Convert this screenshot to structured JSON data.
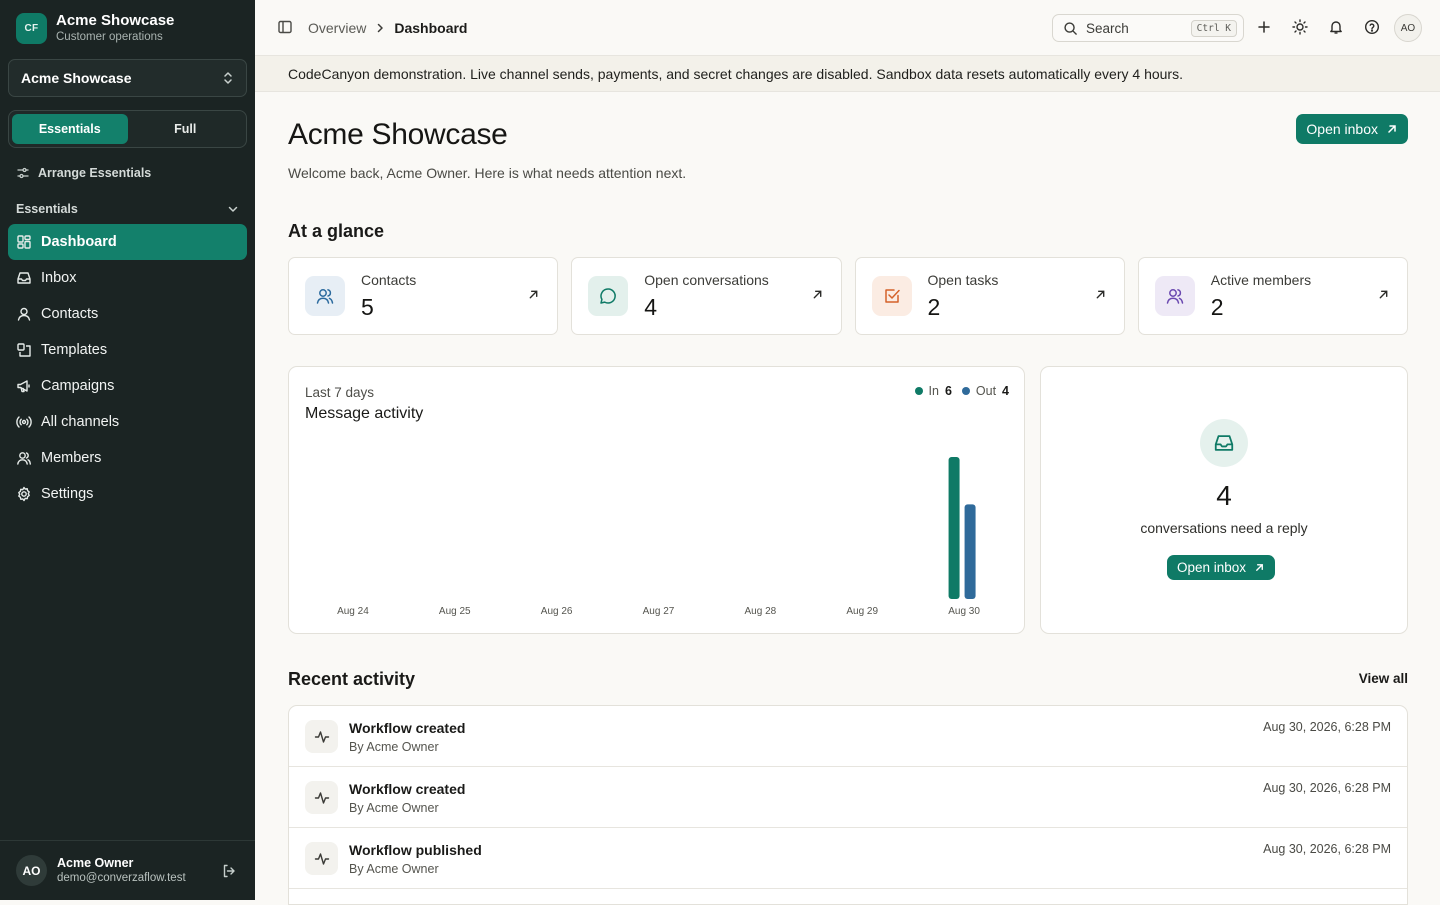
{
  "sidebar": {
    "brand": {
      "initials": "CF",
      "name": "Acme Showcase",
      "subtitle": "Customer operations"
    },
    "workspace": "Acme Showcase",
    "modes": [
      "Essentials",
      "Full"
    ],
    "arrange_label": "Arrange Essentials",
    "section_label": "Essentials",
    "items": [
      {
        "label": "Dashboard",
        "icon": "dashboard-icon",
        "active": true
      },
      {
        "label": "Inbox",
        "icon": "inbox-icon"
      },
      {
        "label": "Contacts",
        "icon": "user-icon"
      },
      {
        "label": "Templates",
        "icon": "templates-icon"
      },
      {
        "label": "Campaigns",
        "icon": "megaphone-icon"
      },
      {
        "label": "All channels",
        "icon": "broadcast-icon"
      },
      {
        "label": "Members",
        "icon": "members-icon"
      },
      {
        "label": "Settings",
        "icon": "gear-icon"
      }
    ],
    "user": {
      "initials": "AO",
      "name": "Acme Owner",
      "email": "demo@converzaflow.test"
    }
  },
  "topbar": {
    "breadcrumb": [
      "Overview",
      "Dashboard"
    ],
    "search_placeholder": "Search",
    "shortcut": "Ctrl K",
    "avatar": "AO"
  },
  "banner": "CodeCanyon demonstration. Live channel sends, payments, and secret changes are disabled. Sandbox data resets automatically every 4 hours.",
  "page": {
    "title": "Acme Showcase",
    "subtitle": "Welcome back, Acme Owner. Here is what needs attention next.",
    "open_inbox": "Open inbox"
  },
  "glance": {
    "heading": "At a glance",
    "stats": [
      {
        "label": "Contacts",
        "value": "5",
        "icon": "users-icon",
        "color": "#2b6a9e",
        "bg": "#e7eef5"
      },
      {
        "label": "Open conversations",
        "value": "4",
        "icon": "chat-icon",
        "color": "#0f7a66",
        "bg": "#e3f0ec"
      },
      {
        "label": "Open tasks",
        "value": "2",
        "icon": "task-check-icon",
        "color": "#d4622a",
        "bg": "#fbece3"
      },
      {
        "label": "Active members",
        "value": "2",
        "icon": "members-icon",
        "color": "#6a48b0",
        "bg": "#eee9f6"
      }
    ]
  },
  "activity_chart": {
    "period": "Last 7 days",
    "title": "Message activity",
    "legend": [
      {
        "name": "In",
        "total": "6",
        "color": "#0f7a66"
      },
      {
        "name": "Out",
        "total": "4",
        "color": "#2f6a9a"
      }
    ]
  },
  "chart_data": {
    "type": "bar",
    "title": "Message activity",
    "categories": [
      "Aug 24",
      "Aug 25",
      "Aug 26",
      "Aug 27",
      "Aug 28",
      "Aug 29",
      "Aug 30"
    ],
    "series": [
      {
        "name": "In",
        "values": [
          0,
          0,
          0,
          0,
          0,
          0,
          6
        ]
      },
      {
        "name": "Out",
        "values": [
          0,
          0,
          0,
          0,
          0,
          0,
          4
        ]
      }
    ],
    "ylim": [
      0,
      6
    ],
    "grid": false,
    "legend": "top-right"
  },
  "reply_card": {
    "count": "4",
    "text": "conversations need a reply",
    "button": "Open inbox"
  },
  "recent": {
    "heading": "Recent activity",
    "view_all": "View all",
    "items": [
      {
        "title": "Workflow created",
        "by": "By Acme Owner",
        "time": "Aug 30, 2026, 6:28 PM"
      },
      {
        "title": "Workflow created",
        "by": "By Acme Owner",
        "time": "Aug 30, 2026, 6:28 PM"
      },
      {
        "title": "Workflow published",
        "by": "By Acme Owner",
        "time": "Aug 30, 2026, 6:28 PM"
      }
    ]
  }
}
